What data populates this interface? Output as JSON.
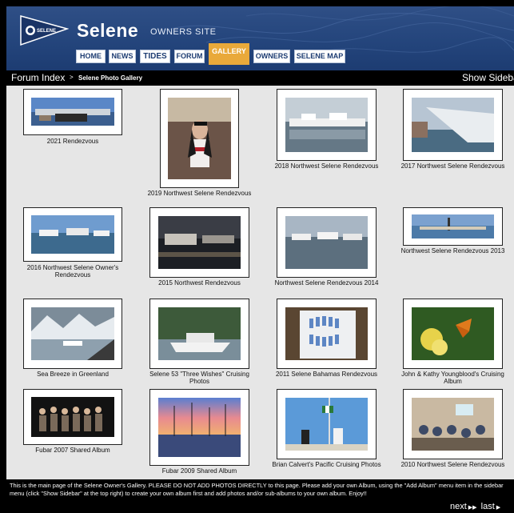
{
  "site": {
    "logo_text": "SELENE",
    "brand": "Selene",
    "brand_sub": "OWNERS SITE"
  },
  "nav": [
    {
      "label": "HOME",
      "active": false
    },
    {
      "label": "NEWS",
      "active": false
    },
    {
      "label": "TIDES",
      "active": false
    },
    {
      "label": "FORUM",
      "active": false
    },
    {
      "label": "GALLERY",
      "active": true
    },
    {
      "label": "OWNERS",
      "active": false
    },
    {
      "label": "SELENE MAP",
      "active": false
    }
  ],
  "breadcrumb": {
    "root": "Forum Index",
    "separator": ">",
    "current": "Selene Photo Gallery"
  },
  "show_sidebar": "Show Sidebar",
  "albums": [
    {
      "caption": "2021 Rendezvous",
      "icon": "marina-panorama-photo"
    },
    {
      "caption": "2019 Northwest Selene Rendezvous",
      "icon": "person-portrait-photo"
    },
    {
      "caption": "2018 Northwest Selene Rendezvous",
      "icon": "marina-boats-photo"
    },
    {
      "caption": "2017 Northwest Selene Rendezvous",
      "icon": "boat-bow-photo"
    },
    {
      "caption": "2016 Northwest Selene Owner's Rendezvous",
      "icon": "harbor-photo"
    },
    {
      "caption": "2015 Northwest Rendezvous",
      "icon": "night-marina-photo"
    },
    {
      "caption": "Northwest Selene Rendezvous 2014",
      "icon": "marina-reflection-photo"
    },
    {
      "caption": "Northwest Selene Rendezvous 2013",
      "icon": "dock-panorama-photo"
    },
    {
      "caption": "Sea Breeze in Greenland",
      "icon": "glacier-photo"
    },
    {
      "caption": "Selene 53 \"Three Wishes\" Cruising Photos",
      "icon": "trawler-photo"
    },
    {
      "caption": "2011 Selene Bahamas Rendezvous",
      "icon": "seating-chart-photo"
    },
    {
      "caption": "John & Kathy Youngblood's Cruising Album",
      "icon": "butterfly-photo"
    },
    {
      "caption": "Fubar 2007 Shared Album",
      "icon": "group-photo"
    },
    {
      "caption": "Fubar 2009 Shared Album",
      "icon": "sunset-marina-photo"
    },
    {
      "caption": "Brian Calvert's Pacific Cruising Photos",
      "icon": "flag-mast-photo"
    },
    {
      "caption": "2010 Northwest Selene Rendezvous",
      "icon": "meeting-room-photo"
    }
  ],
  "footer": {
    "note": "This is the main page of the Selene Owner's Gallery. PLEASE DO NOT ADD PHOTOS DIRECTLY to this page. Please add your own Album, using the \"Add Album\" menu item in the sidebar menu (click \"Show Sidebar\" at the top right) to create your own album first and add photos and/or sub-albums to your own album. Enjoy!!",
    "next": "next",
    "last": "last"
  },
  "colors": {
    "header_blue": "#24457c",
    "gallery_tab": "#e9a93a",
    "gallery_bg": "#e6e6e6"
  }
}
